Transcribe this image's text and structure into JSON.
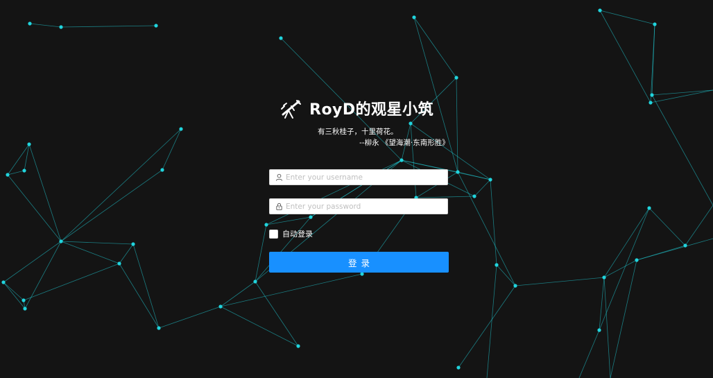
{
  "brand": {
    "title": "RoyD的观星小筑",
    "logo_icon": "telescope-icon"
  },
  "quote": {
    "text": "有三秋桂子，十里荷花。",
    "source": "--柳永 《望海潮·东南形胜》"
  },
  "form": {
    "username_placeholder": "Enter your username",
    "password_placeholder": "Enter your password",
    "remember_label": "自动登录",
    "submit_label": "登录",
    "remember_checked": false
  },
  "colors": {
    "background": "#141414",
    "accent": "#1890ff",
    "network": "#21d4dd"
  }
}
